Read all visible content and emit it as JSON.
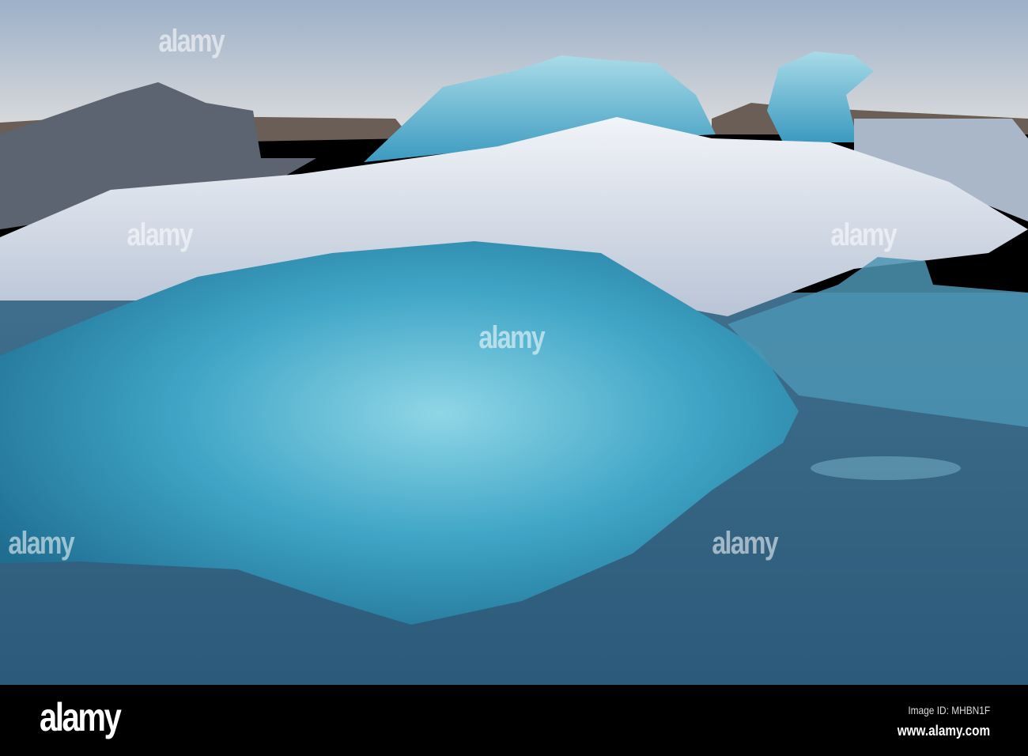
{
  "photo": {
    "subject": "icebergs"
  },
  "watermark": {
    "text": "alamy"
  },
  "footer": {
    "logo": "alamy",
    "image_id": "Image ID: MHBN1F",
    "url": "www.alamy.com"
  }
}
